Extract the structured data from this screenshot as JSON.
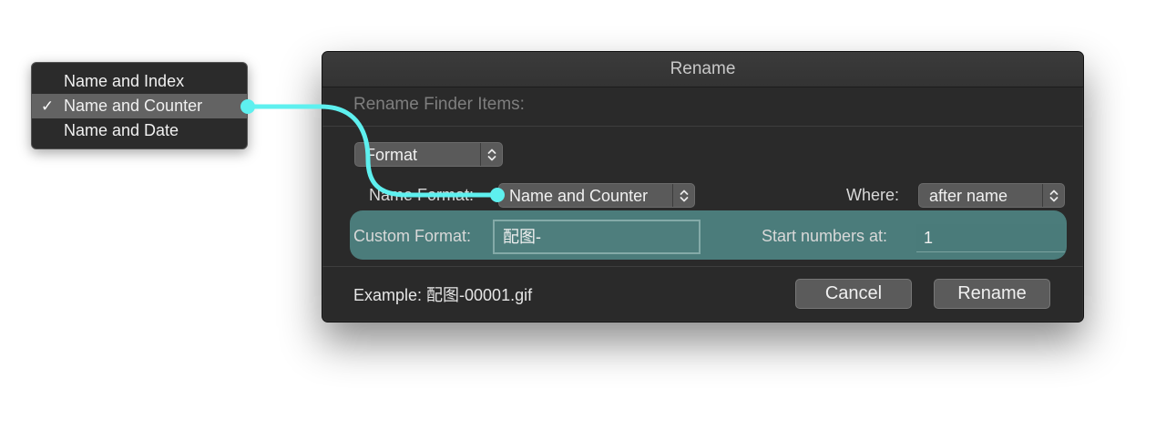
{
  "popup_menu": {
    "items": [
      {
        "label": "Name and Index",
        "checked": false
      },
      {
        "label": "Name and Counter",
        "checked": true
      },
      {
        "label": "Name and Date",
        "checked": false
      }
    ],
    "check_glyph": "✓"
  },
  "dialog": {
    "title": "Rename",
    "subtitle": "Rename Finder Items:",
    "mode_popup": "Format",
    "name_format_label": "Name Format:",
    "name_format_value": "Name and Counter",
    "where_label": "Where:",
    "where_value": "after name",
    "custom_format_label": "Custom Format:",
    "custom_format_value": "配图-",
    "start_numbers_label": "Start numbers at:",
    "start_numbers_value": "1",
    "example_text": "Example: 配图-00001.gif",
    "cancel_label": "Cancel",
    "rename_label": "Rename"
  },
  "colors": {
    "highlight": "#4b7c7b",
    "connector": "#5ef0ef",
    "dialog_bg": "#2a2a2a"
  },
  "icons": {
    "stepper": "up-down-chevron-icon",
    "check": "checkmark-icon"
  }
}
